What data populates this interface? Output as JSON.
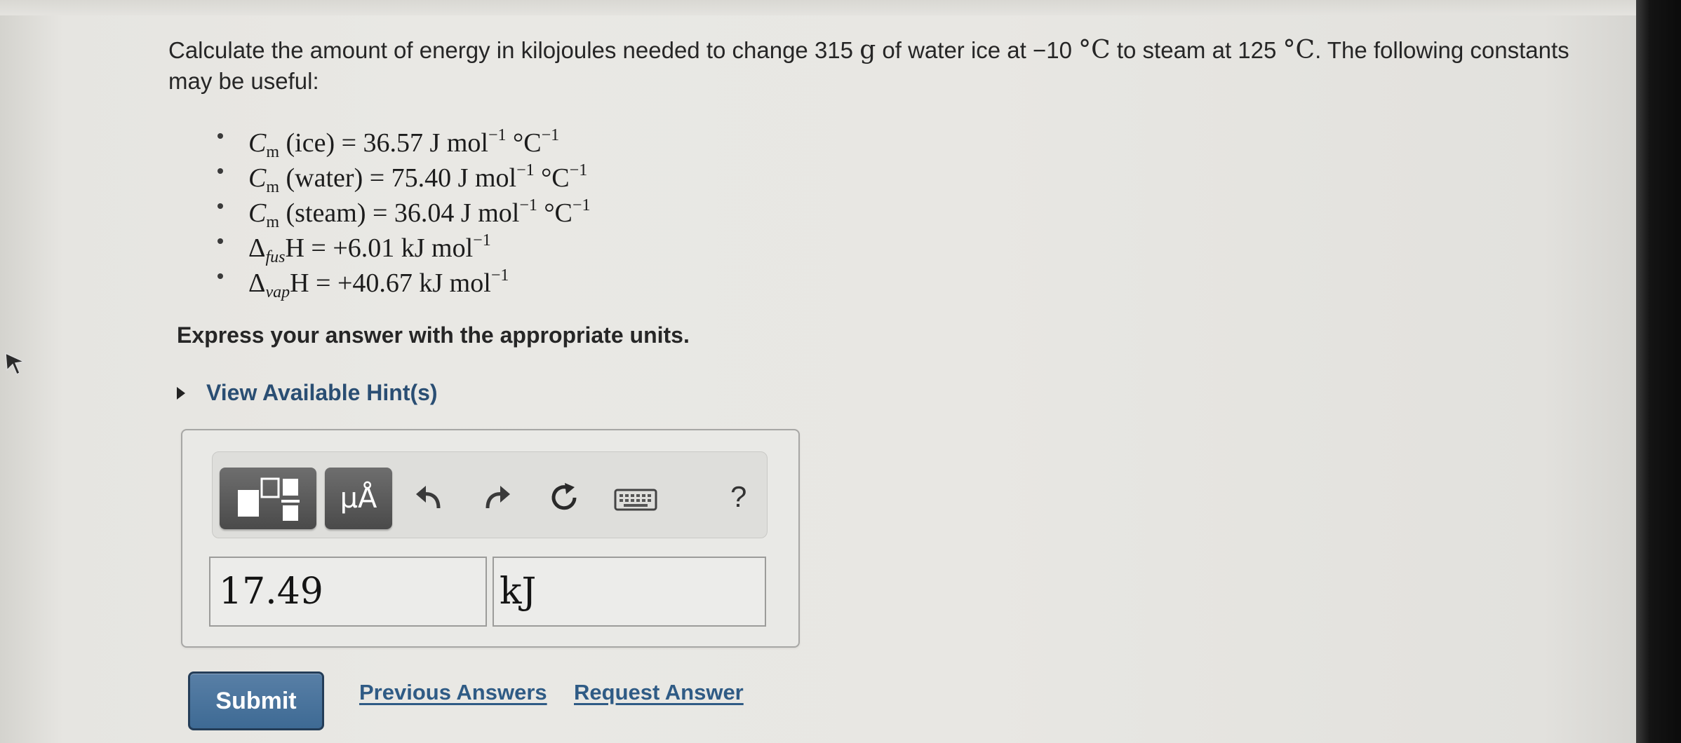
{
  "question": {
    "intro": "Calculate the amount of energy in kilojoules needed to change 315 ",
    "mass_unit": "g",
    "mid1": " of water ice at −10 ",
    "temp_unit_1": "°C",
    "mid2": " to steam at 125 ",
    "temp_unit_2": "°C",
    "tail": ". The following constants may be useful:"
  },
  "constants": [
    {
      "sym": "C",
      "sub": "m",
      "text": " (ice) = 36.57 J mol",
      "sup1": "−1",
      "mid": " °C",
      "sup2": "−1"
    },
    {
      "sym": "C",
      "sub": "m",
      "text": " (water) = 75.40 J mol",
      "sup1": "−1",
      "mid": " °C",
      "sup2": "−1"
    },
    {
      "sym": "C",
      "sub": "m",
      "text": " (steam) = 36.04 J mol",
      "sup1": "−1",
      "mid": " °C",
      "sup2": "−1"
    },
    {
      "sym": "Δ",
      "sub": "fus",
      "text": "H = +6.01 kJ mol",
      "sup1": "−1",
      "mid": "",
      "sup2": ""
    },
    {
      "sym": "Δ",
      "sub": "vap",
      "text": "H = +40.67 kJ mol",
      "sup1": "−1",
      "mid": "",
      "sup2": ""
    }
  ],
  "express_text": "Express your answer with the appropriate units.",
  "hint_label": "View Available Hint(s)",
  "toolbar": {
    "templates_icon": "fraction-template-icon",
    "units_label": "μÅ",
    "undo_icon": "undo-icon",
    "redo_icon": "redo-icon",
    "reset_icon": "reset-icon",
    "keyboard_icon": "keyboard-icon",
    "help_label": "?"
  },
  "answer": {
    "value": "17.49",
    "unit": "kJ"
  },
  "actions": {
    "submit_label": "Submit",
    "previous_answers_label": "Previous Answers",
    "request_answer_label": "Request Answer"
  },
  "colors": {
    "link": "#2f5b85",
    "submit_bg": "#4a76a0",
    "toolbar_button": "#5a5a5a"
  }
}
